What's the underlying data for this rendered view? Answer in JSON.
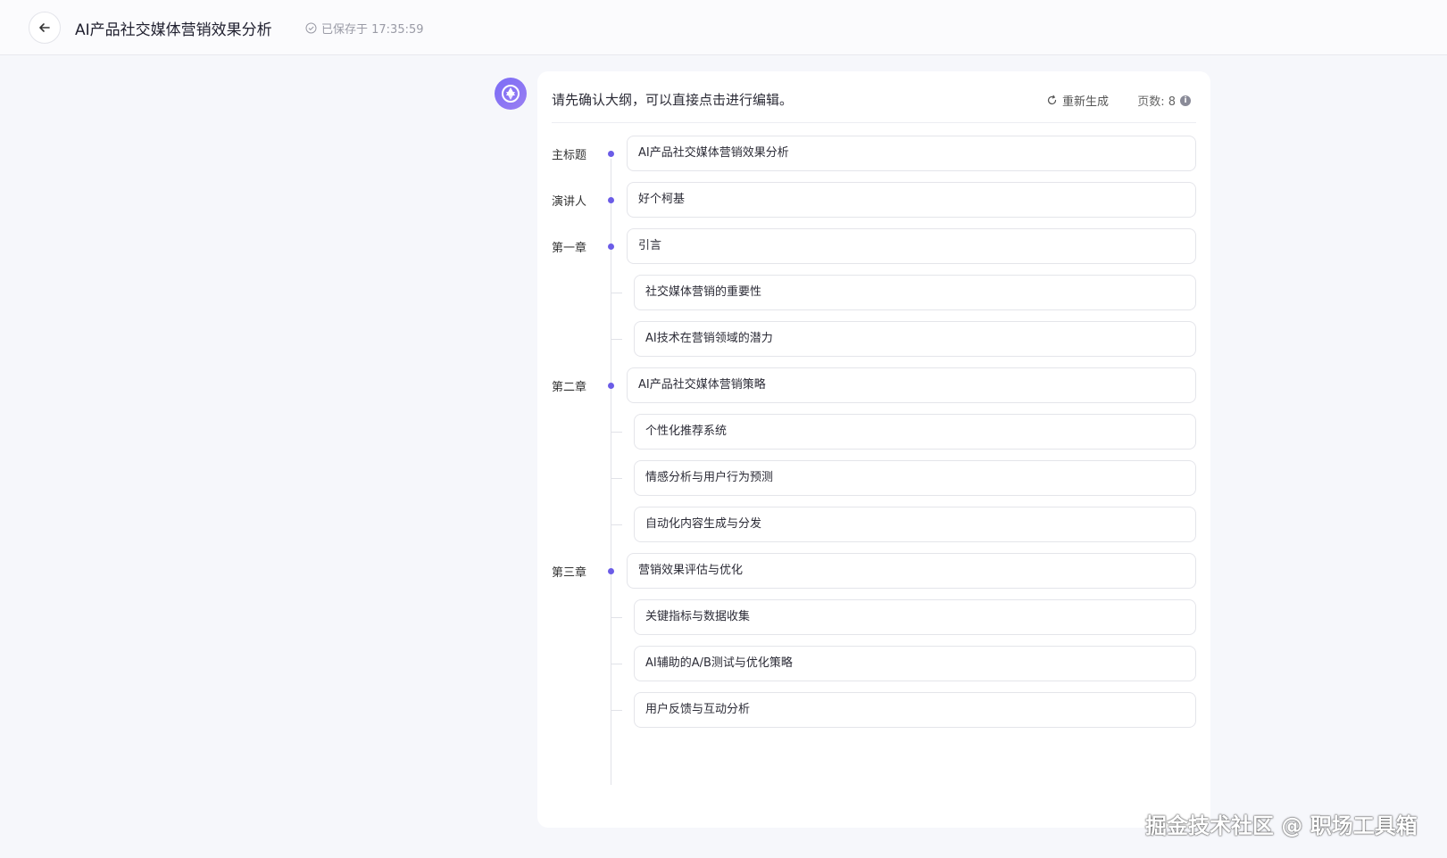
{
  "topbar": {
    "title": "AI产品社交媒体营销效果分析",
    "save_status": "已保存于 17:35:59"
  },
  "card": {
    "instruction": "请先确认大纲，可以直接点击进行编辑。",
    "regenerate_label": "重新生成",
    "pages_label": "页数: 8",
    "info_glyph": "i"
  },
  "outline": [
    {
      "label": "主标题",
      "text": "AI产品社交媒体营销效果分析",
      "level": 0
    },
    {
      "label": "演讲人",
      "text": "好个柯基",
      "level": 0
    },
    {
      "label": "第一章",
      "text": "引言",
      "level": 0
    },
    {
      "label": "",
      "text": "社交媒体营销的重要性",
      "level": 1
    },
    {
      "label": "",
      "text": "AI技术在营销领域的潜力",
      "level": 1
    },
    {
      "label": "第二章",
      "text": "AI产品社交媒体营销策略",
      "level": 0
    },
    {
      "label": "",
      "text": "个性化推荐系统",
      "level": 1
    },
    {
      "label": "",
      "text": "情感分析与用户行为预测",
      "level": 1
    },
    {
      "label": "",
      "text": "自动化内容生成与分发",
      "level": 1
    },
    {
      "label": "第三章",
      "text": "营销效果评估与优化",
      "level": 0
    },
    {
      "label": "",
      "text": "关键指标与数据收集",
      "level": 1
    },
    {
      "label": "",
      "text": "AI辅助的A/B测试与优化策略",
      "level": 1
    },
    {
      "label": "",
      "text": "用户反馈与互动分析",
      "level": 1
    }
  ],
  "watermark": "掘金技术社区 @ 职场工具箱",
  "colors": {
    "accent": "#6b5ce7",
    "background": "#f6f7fb"
  }
}
